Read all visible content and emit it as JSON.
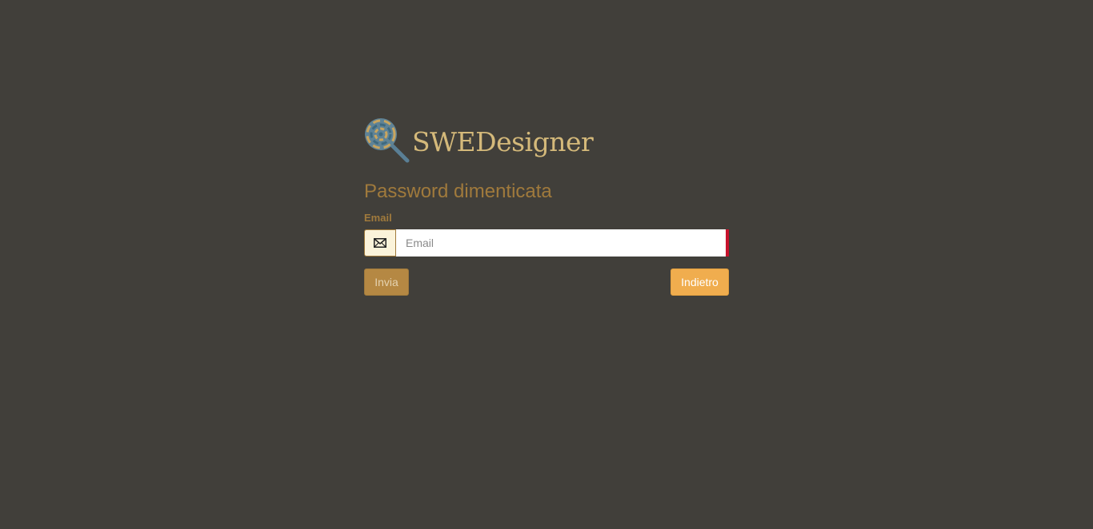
{
  "brand": {
    "name": "SWEDesigner",
    "logo_icon": "lollipop-magnifier-icon"
  },
  "form": {
    "title": "Password dimenticata",
    "email_label": "Email",
    "email_placeholder": "Email",
    "email_value": "",
    "email_icon": "envelope-icon",
    "submit_label": "Invia",
    "back_label": "Indietro"
  },
  "colors": {
    "background": "#413f3a",
    "accent": "#a07a3c",
    "brand_text": "#d4b97a",
    "back_button": "#f0ad4e",
    "submit_button": "#b58843",
    "error_marker": "#c7122c"
  }
}
